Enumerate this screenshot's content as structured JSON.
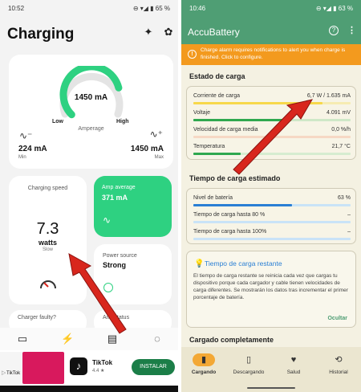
{
  "left": {
    "status": {
      "time": "10:52",
      "icons": "⊖ ▾◢ ▮ 65 %"
    },
    "title": "Charging",
    "amperage_card": {
      "value": "1450 mA",
      "low": "Low",
      "high": "High",
      "label": "Amperage",
      "gauge_fraction": 0.78,
      "min_value": "224 mA",
      "min_label": "Min",
      "max_value": "1450 mA",
      "max_label": "Max"
    },
    "speed_card": {
      "label": "Charging speed",
      "value": "7.3",
      "unit": "watts",
      "state": "Slow"
    },
    "avg_card": {
      "label": "Amp average",
      "value": "371 mA"
    },
    "power_card": {
      "label": "Power source",
      "value": "Strong"
    },
    "fault_card": {
      "label": "Charger faulty?"
    },
    "adjust_card": {
      "label": "Ampstatus"
    },
    "ad": {
      "thumb_label": "TikTok",
      "logo": "♪",
      "name": "TikTok",
      "rating": "4.4 ★",
      "button": "INSTALAR",
      "close": "▷"
    }
  },
  "right": {
    "status": {
      "time": "10:46",
      "icons": "⊖ ▾◢ ▮ 63 %"
    },
    "app_title": "AccuBattery",
    "alert": "Charge alarm requires notifications to alert you when charge is finished. Click to configure.",
    "estado": {
      "title": "Estado de carga",
      "rows": [
        {
          "label": "Corriente de carga",
          "value": "6,7 W / 1.635 mA",
          "fill": 0.82,
          "color": "#f7d84a"
        },
        {
          "label": "Voltaje",
          "value": "4.091 mV",
          "fill": 0.62,
          "color": "#2fa84f"
        },
        {
          "label": "Velocidad de carga media",
          "value": "0,0 %/h",
          "fill": 0.0,
          "color": "#f2c6a8"
        },
        {
          "label": "Temperatura",
          "value": "21,7 °C",
          "fill": 0.3,
          "color": "#2fa84f"
        }
      ]
    },
    "tiempo": {
      "title": "Tiempo de carga estimado",
      "rows": [
        {
          "label": "Nivel de batería",
          "value": "63 %",
          "fill": 0.63,
          "color": "#2a7fd4"
        },
        {
          "label": "Tiempo de carga hasta 80 %",
          "value": "–",
          "fill": 0.0,
          "color": "#2a7fd4"
        },
        {
          "label": "Tiempo de carga hasta 100%",
          "value": "–",
          "fill": 0.0,
          "color": "#2a7fd4"
        }
      ]
    },
    "tip": {
      "title": "Tiempo de carga restante",
      "body": "El tiempo de carga restante se reinicia cada vez que cargas tu dispositivo porque cada cargador y cable tienen velocidades de carga diferentes. Se mostrarán los datos tras incrementar el primer porcentaje de batería.",
      "hide": "Ocultar"
    },
    "completo": {
      "title": "Cargado completamente"
    },
    "nav": [
      {
        "label": "Cargando",
        "icon": "▮",
        "selected": true
      },
      {
        "label": "Descargando",
        "icon": "▯",
        "selected": false
      },
      {
        "label": "Salud",
        "icon": "♥",
        "selected": false
      },
      {
        "label": "Historial",
        "icon": "⟲",
        "selected": false
      }
    ]
  },
  "colors": {
    "accent_green": "#2ed181",
    "app_green": "#4f9e74",
    "alert_orange": "#f39a1e",
    "arrow_red": "#d8261d"
  }
}
